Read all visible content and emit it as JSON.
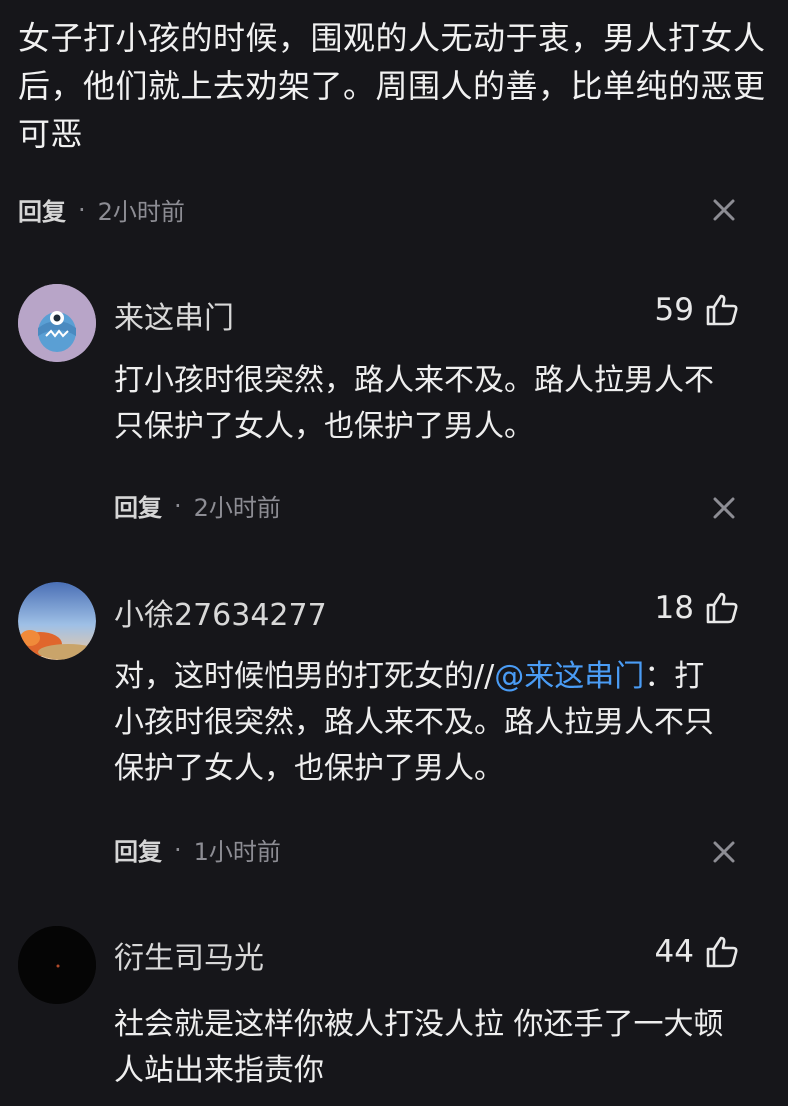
{
  "main_comment": {
    "text": "女子打小孩的时候，围观的人无动于衷，男人打女人后，他们就上去劝架了。周围人的善，比单纯的恶更可恶",
    "reply_label": "回复",
    "separator": "·",
    "time": "2小时前"
  },
  "replies": [
    {
      "username": "来这串门",
      "likes": "59",
      "text": "打小孩时很突然，路人来不及。路人拉男人不只保护了女人，也保护了男人。",
      "reply_label": "回复",
      "separator": "·",
      "time": "2小时前"
    },
    {
      "username": "小徐27634277",
      "likes": "18",
      "text_before": "对，这时候怕男的打死女的//",
      "mention": "@来这串门",
      "text_after": "：打小孩时很突然，路人来不及。路人拉男人不只保护了女人，也保护了男人。",
      "reply_label": "回复",
      "separator": "·",
      "time": "1小时前"
    },
    {
      "username": "衍生司马光",
      "likes": "44",
      "text": "社会就是这样你被人打没人拉 你还手了一大顿人站出来指责你"
    }
  ],
  "colors": {
    "background": "#16161a",
    "text": "#eeeeee",
    "muted": "#8d8d94",
    "mention": "#4a9cf5"
  },
  "icons": [
    "close-icon",
    "thumbs-up-icon"
  ]
}
